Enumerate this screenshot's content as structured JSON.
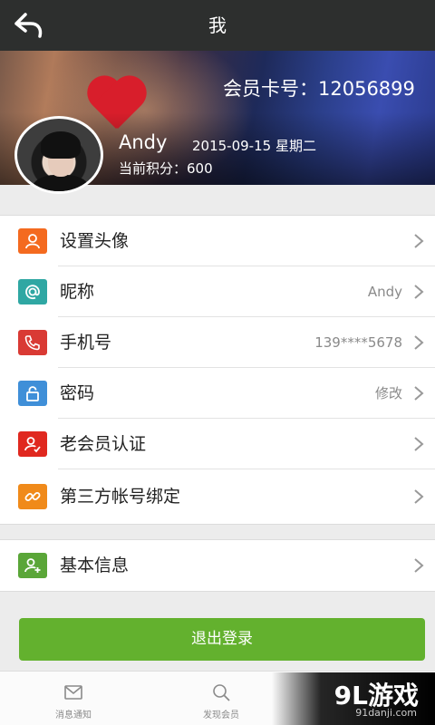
{
  "header": {
    "title": "我",
    "back_icon": "back-arrow-icon"
  },
  "profile": {
    "card_number_label": "会员卡号：12056899",
    "name": "Andy",
    "date": "2015-09-15  星期二",
    "points": "当前积分：600"
  },
  "menu_group_1": [
    {
      "label": "设置头像",
      "value": "",
      "icon": "user-icon",
      "color": "#f46a1f"
    },
    {
      "label": "昵称",
      "value": "Andy",
      "icon": "at-icon",
      "color": "#2fa7a3"
    },
    {
      "label": "手机号",
      "value": "139****5678",
      "icon": "phone-icon",
      "color": "#d93a34"
    },
    {
      "label": "密码",
      "value": "修改",
      "icon": "lock-icon",
      "color": "#3f8fd8"
    },
    {
      "label": "老会员认证",
      "value": "",
      "icon": "user-check-icon",
      "color": "#e0281f"
    },
    {
      "label": "第三方帐号绑定",
      "value": "",
      "icon": "link-icon",
      "color": "#f08a1a"
    }
  ],
  "menu_group_2": [
    {
      "label": "基本信息",
      "value": "",
      "icon": "user-add-icon",
      "color": "#5aa638"
    }
  ],
  "logout_label": "退出登录",
  "tabs": [
    {
      "label": "消息通知",
      "icon": "mail-icon"
    },
    {
      "label": "发现会员",
      "icon": "search-icon"
    }
  ],
  "watermark": {
    "main": "9L游戏",
    "sub": "91danji.com"
  },
  "colors": {
    "topbar": "#2d2f2e",
    "logout": "#63b12e",
    "background": "#ececec"
  }
}
